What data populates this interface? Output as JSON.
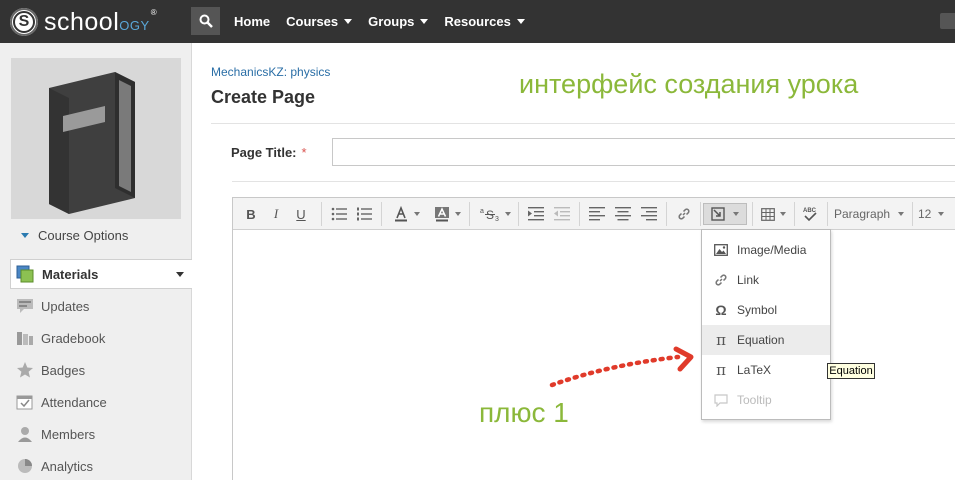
{
  "topbar": {
    "logo_s": "S",
    "logo_main": "schoo",
    "logo_accent": "l",
    "logo_tail": "ogy",
    "logo_mark": "®",
    "nav": [
      {
        "label": "Home",
        "has_caret": false
      },
      {
        "label": "Courses",
        "has_caret": true
      },
      {
        "label": "Groups",
        "has_caret": true
      },
      {
        "label": "Resources",
        "has_caret": true
      }
    ]
  },
  "sidebar": {
    "course_options": "Course Options",
    "active_item": "Materials",
    "items": [
      {
        "label": "Updates",
        "icon": "updates-icon"
      },
      {
        "label": "Gradebook",
        "icon": "gradebook-icon"
      },
      {
        "label": "Badges",
        "icon": "badge-icon"
      },
      {
        "label": "Attendance",
        "icon": "attendance-icon"
      },
      {
        "label": "Members",
        "icon": "members-icon"
      },
      {
        "label": "Analytics",
        "icon": "analytics-icon"
      }
    ]
  },
  "main": {
    "breadcrumb": "MechanicsKZ: physics",
    "page_title": "Create Page",
    "title_label": "Page Title:",
    "required_mark": "*",
    "title_value": "",
    "annotation_top": "интерфейс создания урока",
    "annotation_bottom": "плюс 1"
  },
  "toolbar": {
    "bold": "B",
    "italic": "I",
    "underline": "U",
    "paragraph": "Paragraph",
    "font_size": "12"
  },
  "insert_menu": {
    "items": [
      {
        "label": "Image/Media",
        "icon": "image-icon",
        "state": "normal"
      },
      {
        "label": "Link",
        "icon": "link-icon",
        "state": "normal"
      },
      {
        "label": "Symbol",
        "icon": "omega-icon",
        "state": "normal"
      },
      {
        "label": "Equation",
        "icon": "pi-icon",
        "state": "hover"
      },
      {
        "label": "LaTeX",
        "icon": "pi-icon",
        "state": "normal"
      },
      {
        "label": "Tooltip",
        "icon": "speech-bubble-icon",
        "state": "disabled"
      }
    ],
    "tooltip": "Equation"
  },
  "colors": {
    "topbar": "#333333",
    "link": "#2a6ea6",
    "annotation": "#8bb83a",
    "arrow": "#e03a2a",
    "required": "#d9534f"
  }
}
